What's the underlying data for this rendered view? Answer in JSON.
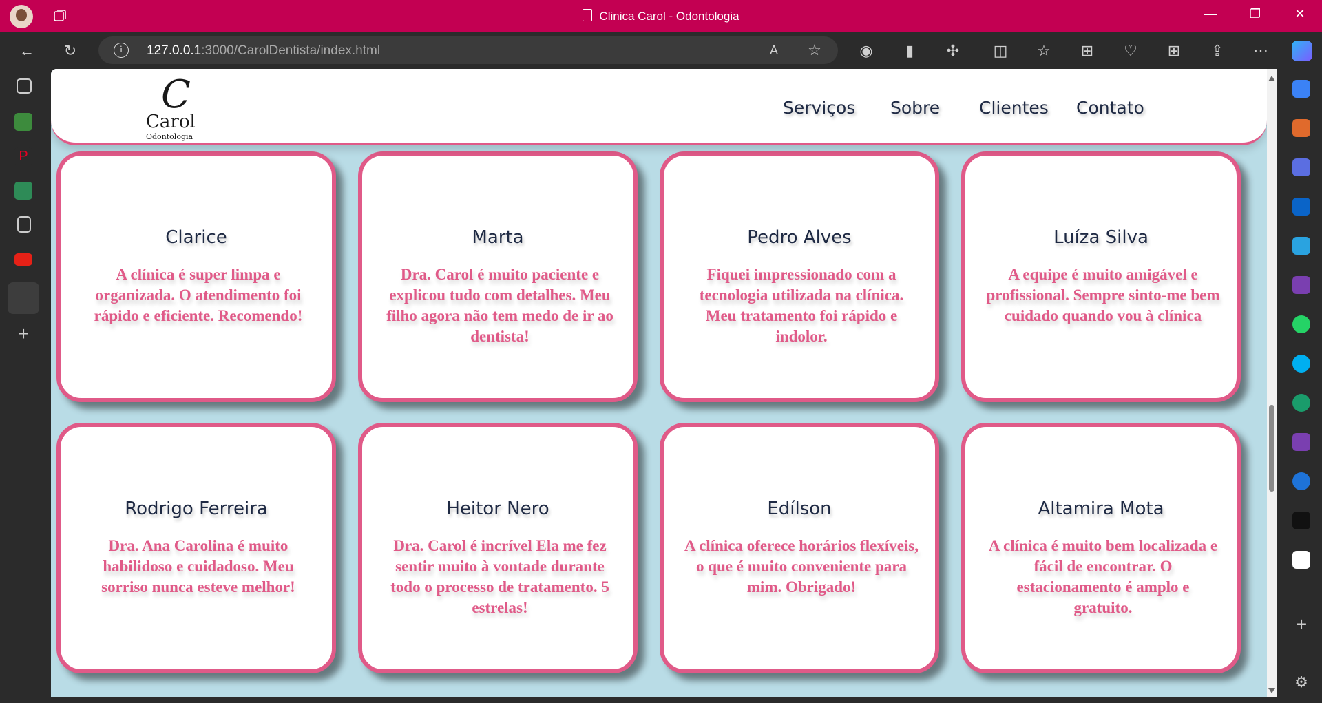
{
  "browser": {
    "window_title": "Clinica Carol - Odontologia",
    "url_host": "127.0.0.1",
    "url_path": ":3000/CarolDentista/index.html",
    "window_controls": {
      "minimize": "—",
      "restore": "❐",
      "close": "✕"
    },
    "accent_color": "#c30052"
  },
  "site": {
    "logo": {
      "mark": "C",
      "name": "Carol",
      "subtitle": "Odontologia"
    },
    "nav": [
      "Serviços",
      "Sobre",
      "Clientes",
      "Contato"
    ],
    "colors": {
      "accent": "#e05a88",
      "background": "#b9dce6",
      "heading": "#1f2a44"
    }
  },
  "testimonials": [
    {
      "name": "Clarice",
      "text": "A clínica é super limpa e organizada. O atendimento foi rápido e eficiente. Recomendo!"
    },
    {
      "name": "Marta",
      "text": "Dra. Carol é muito paciente e explicou tudo com detalhes. Meu filho agora não tem medo de ir ao dentista!"
    },
    {
      "name": "Pedro Alves",
      "text": "Fiquei impressionado com a tecnologia utilizada na clínica. Meu tratamento foi rápido e indolor."
    },
    {
      "name": "Luíza Silva",
      "text": "A equipe é muito amigável e profissional. Sempre sinto-me bem cuidado quando vou à clínica"
    },
    {
      "name": "Rodrigo Ferreira",
      "text": "Dra. Ana Carolina é muito habilidoso e cuidadoso. Meu sorriso nunca esteve melhor!"
    },
    {
      "name": "Heitor Nero",
      "text": "Dra. Carol é incrível Ela me fez sentir muito à vontade durante todo o processo de tratamento. 5 estrelas!"
    },
    {
      "name": "Edílson",
      "text": "A clínica oferece horários flexíveis, o que é muito conveniente para mim. Obrigado!"
    },
    {
      "name": "Altamira Mota",
      "text": "A clínica é muito bem localizada e fácil de encontrar. O estacionamento é amplo e gratuito."
    }
  ]
}
